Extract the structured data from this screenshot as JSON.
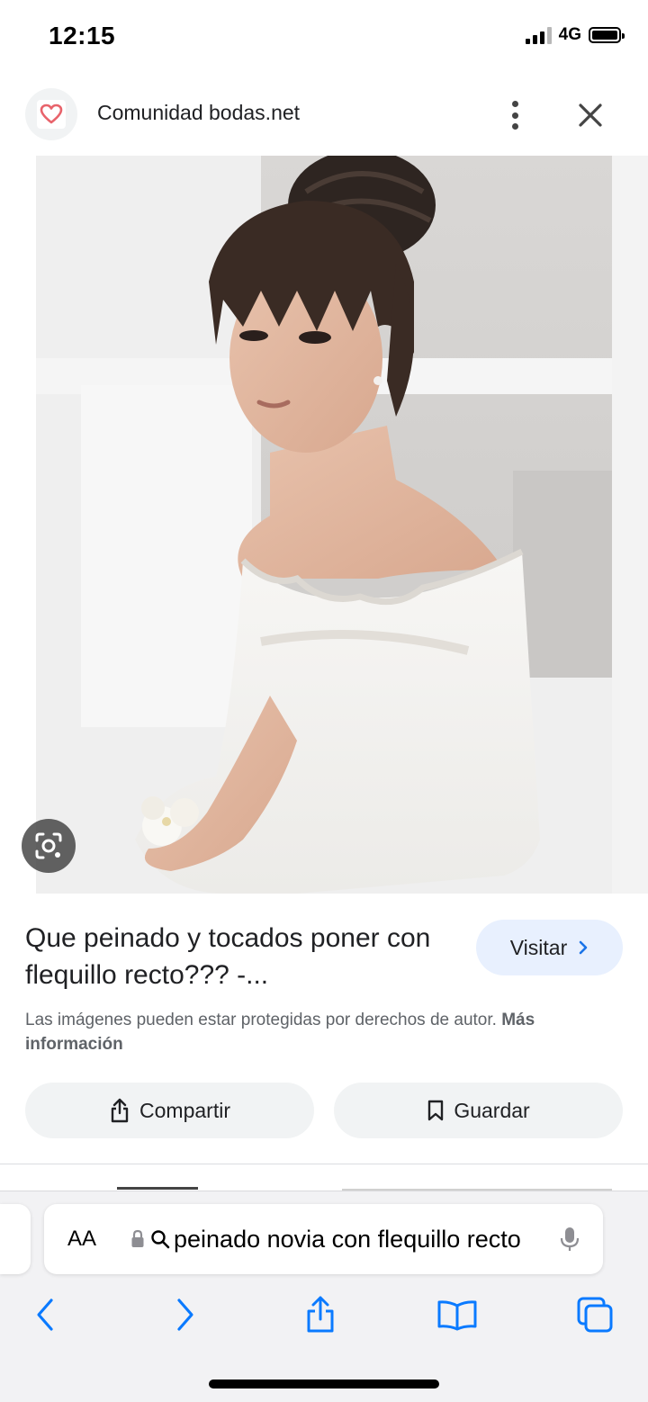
{
  "status_bar": {
    "time": "12:15",
    "network": "4G"
  },
  "source": {
    "name": "Comunidad bodas.net",
    "logo_icon": "heart-icon"
  },
  "result": {
    "title": "Que peinado y tocados poner con flequillo recto??? -...",
    "visit_label": "Visitar",
    "copyright_text": "Las imágenes pueden estar protegidas por derechos de autor.",
    "more_info_label": "Más información",
    "share_label": "Compartir",
    "save_label": "Guardar"
  },
  "browser": {
    "aa_label": "AA",
    "query": "peinado novia con flequillo recto"
  },
  "colors": {
    "accent_heart": "#e8636b",
    "visit_bg": "#e8f0fe",
    "pill_bg": "#f1f3f4",
    "safari_blue": "#0a7aff"
  }
}
